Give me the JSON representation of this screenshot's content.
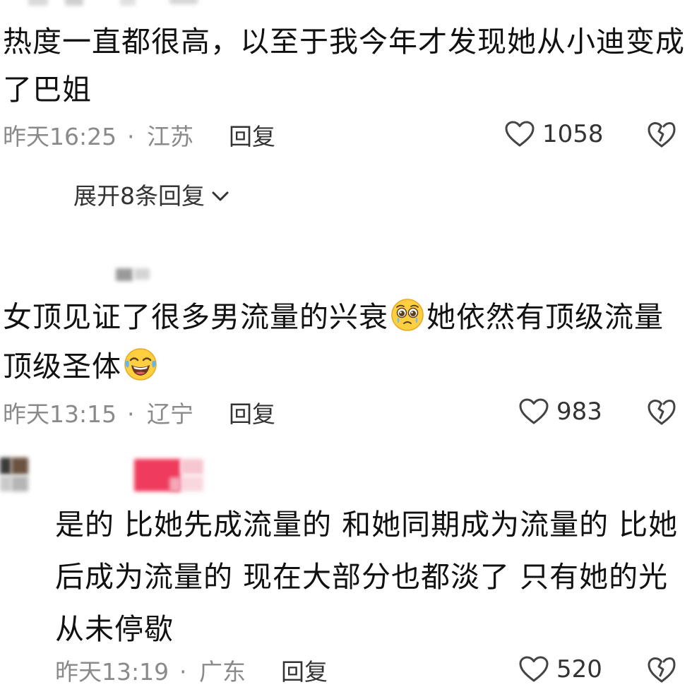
{
  "comments": [
    {
      "lines": [
        "热度一直都很高，以至于我今年才发现她从小迪变成",
        "了巴姐"
      ],
      "time": "昨天16:25",
      "sep": "·",
      "location": "江苏",
      "reply": "回复",
      "likes": "1058",
      "expand": "展开8条回复"
    },
    {
      "line1_a": "女顶见证了很多男流量的兴衰",
      "line1_b": "她依然有顶级流量",
      "line2": "顶级圣体",
      "emoji1": "pleading-face-emoji",
      "emoji2": "laughing-tears-emoji",
      "time": "昨天13:15",
      "sep": "·",
      "location": "辽宁",
      "reply": "回复",
      "likes": "983"
    },
    {
      "lines": [
        "是的 比她先成流量的 和她同期成为流量的 比她",
        "后成为流量的 现在大部分也都淡了 只有她的光",
        "从未停歇"
      ],
      "time": "昨天13:19",
      "sep": "·",
      "location": "广东",
      "reply": "回复",
      "likes": "520"
    }
  ],
  "icons": {
    "like": "heart-outline-icon",
    "dislike": "broken-heart-icon",
    "expand": "chevron-down-icon"
  },
  "colors": {
    "meta": "#8a8a8a",
    "text": "#111111",
    "avatar_pink": "#ef3b5c"
  }
}
